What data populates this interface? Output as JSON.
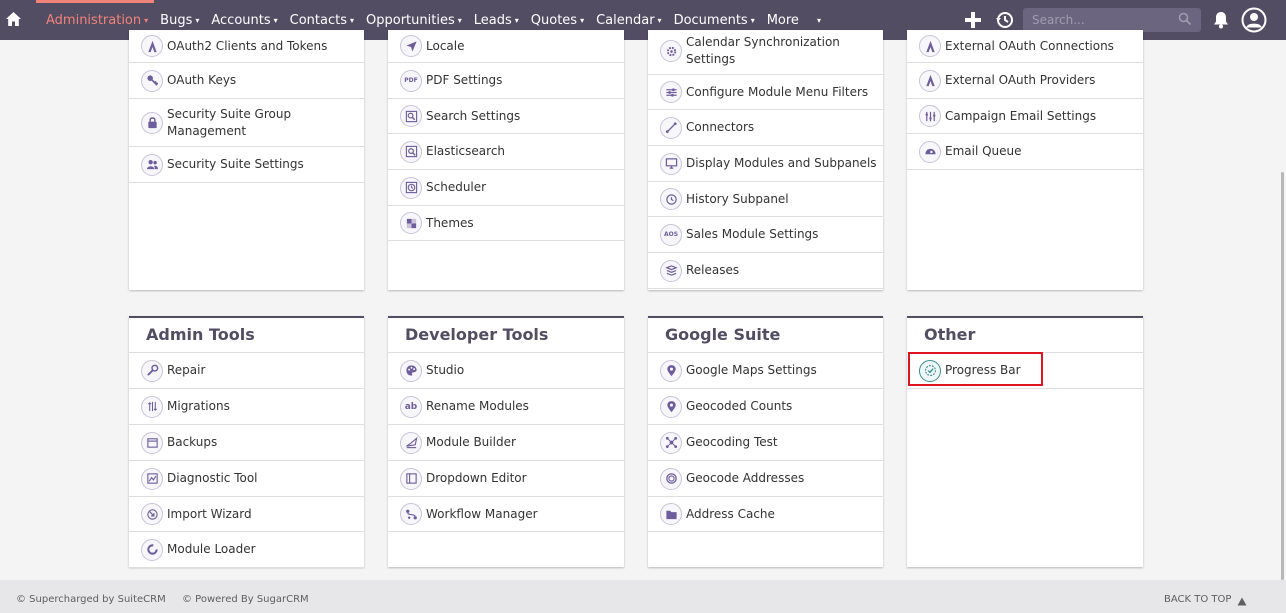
{
  "navbar": {
    "items": [
      {
        "label": "Administration"
      },
      {
        "label": "Bugs"
      },
      {
        "label": "Accounts"
      },
      {
        "label": "Contacts"
      },
      {
        "label": "Opportunities"
      },
      {
        "label": "Leads"
      },
      {
        "label": "Quotes"
      },
      {
        "label": "Calendar"
      },
      {
        "label": "Documents"
      },
      {
        "label": "More"
      }
    ],
    "search_placeholder": "Search...",
    "accent_color": "#f08377",
    "bg_color": "#534d64"
  },
  "panels_top": [
    {
      "rows": [
        {
          "label": "OAuth2 Clients and Tokens",
          "icon": "oauth-icon"
        },
        {
          "label": "OAuth Keys",
          "icon": "key-icon"
        },
        {
          "label": "Security Suite Group Management",
          "icon": "lock-icon"
        },
        {
          "label": "Security Suite Settings",
          "icon": "users-icon"
        }
      ]
    },
    {
      "rows": [
        {
          "label": "Locale",
          "icon": "location-arrow-icon"
        },
        {
          "label": "PDF Settings",
          "icon": "pdf-icon"
        },
        {
          "label": "Search Settings",
          "icon": "search-settings-icon"
        },
        {
          "label": "Elasticsearch",
          "icon": "elasticsearch-icon"
        },
        {
          "label": "Scheduler",
          "icon": "clock-icon"
        },
        {
          "label": "Themes",
          "icon": "themes-icon"
        }
      ]
    },
    {
      "rows": [
        {
          "label": "Calendar Synchronization Settings",
          "icon": "gear-icon"
        },
        {
          "label": "Configure Module Menu Filters",
          "icon": "sliders-icon"
        },
        {
          "label": "Connectors",
          "icon": "connectors-icon"
        },
        {
          "label": "Display Modules and Subpanels",
          "icon": "monitor-icon"
        },
        {
          "label": "History Subpanel",
          "icon": "history-icon"
        },
        {
          "label": "Sales Module Settings",
          "icon": "aos-icon"
        },
        {
          "label": "Releases",
          "icon": "layers-icon"
        }
      ]
    },
    {
      "rows": [
        {
          "label": "External OAuth Connections",
          "icon": "oauth-icon"
        },
        {
          "label": "External OAuth Providers",
          "icon": "oauth-icon"
        },
        {
          "label": "Campaign Email Settings",
          "icon": "campaign-icon"
        },
        {
          "label": "Email Queue",
          "icon": "email-queue-icon"
        }
      ]
    }
  ],
  "panels_bottom": [
    {
      "title": "Admin Tools",
      "rows": [
        {
          "label": "Repair",
          "icon": "wrench-icon"
        },
        {
          "label": "Migrations",
          "icon": "migrations-icon"
        },
        {
          "label": "Backups",
          "icon": "backup-icon"
        },
        {
          "label": "Diagnostic Tool",
          "icon": "diagnostic-icon"
        },
        {
          "label": "Import Wizard",
          "icon": "import-icon"
        },
        {
          "label": "Module Loader",
          "icon": "module-loader-icon"
        }
      ]
    },
    {
      "title": "Developer Tools",
      "rows": [
        {
          "label": "Studio",
          "icon": "palette-icon"
        },
        {
          "label": "Rename Modules",
          "icon": "rename-icon"
        },
        {
          "label": "Module Builder",
          "icon": "module-builder-icon"
        },
        {
          "label": "Dropdown Editor",
          "icon": "dropdown-editor-icon"
        },
        {
          "label": "Workflow Manager",
          "icon": "workflow-icon"
        }
      ]
    },
    {
      "title": "Google Suite",
      "rows": [
        {
          "label": "Google Maps Settings",
          "icon": "map-pin-icon"
        },
        {
          "label": "Geocoded Counts",
          "icon": "map-pin-icon"
        },
        {
          "label": "Geocoding Test",
          "icon": "geocoding-test-icon"
        },
        {
          "label": "Geocode Addresses",
          "icon": "geocode-addresses-icon"
        },
        {
          "label": "Address Cache",
          "icon": "folder-icon"
        }
      ]
    },
    {
      "title": "Other",
      "rows": [
        {
          "label": "Progress Bar",
          "icon": "progress-bar-icon"
        }
      ]
    }
  ],
  "footer": {
    "left_1": "© Supercharged by SuiteCRM",
    "left_2": "© Powered By SugarCRM",
    "back_to_top": "BACK TO TOP"
  }
}
